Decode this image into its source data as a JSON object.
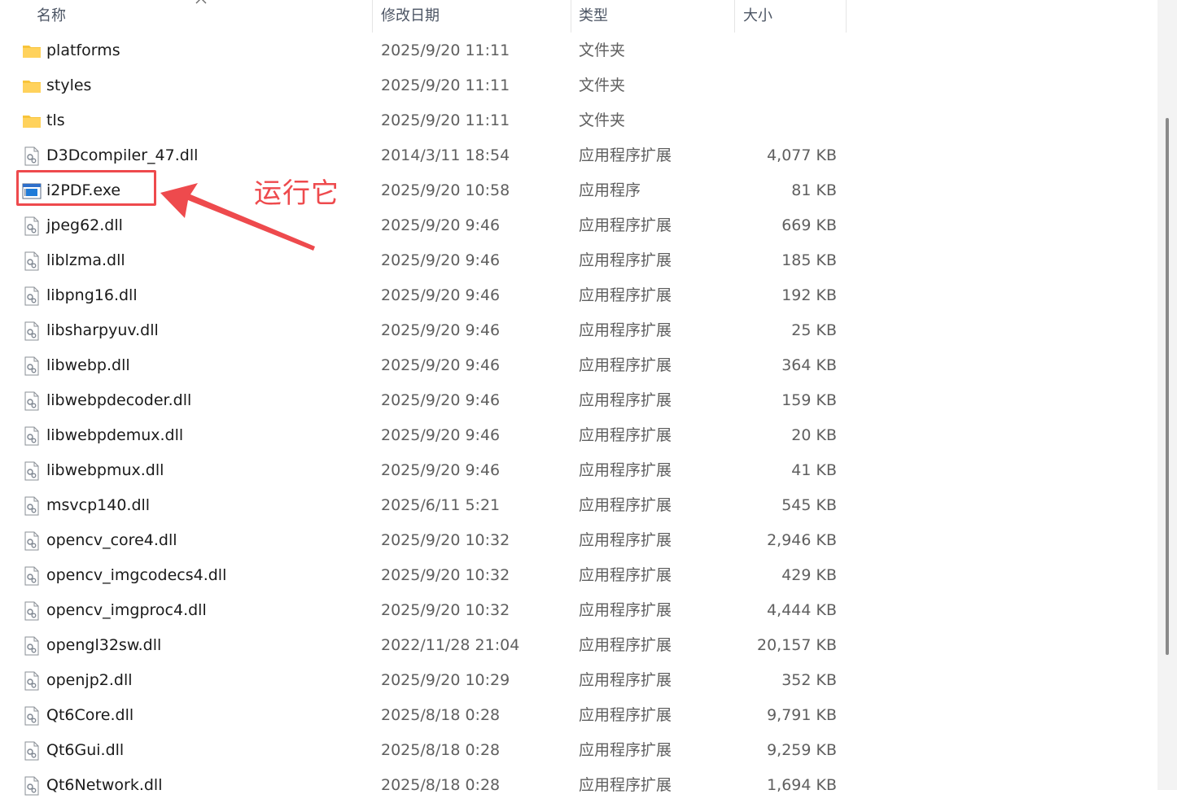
{
  "columns": {
    "name": "名称",
    "date": "修改日期",
    "type": "类型",
    "size": "大小"
  },
  "annotation": {
    "label": "运行它",
    "color": "#ee4a4d"
  },
  "files": [
    {
      "name": "platforms",
      "date": "2025/9/20 11:11",
      "type": "文件夹",
      "size": "",
      "icon": "folder-icon"
    },
    {
      "name": "styles",
      "date": "2025/9/20 11:11",
      "type": "文件夹",
      "size": "",
      "icon": "folder-icon"
    },
    {
      "name": "tls",
      "date": "2025/9/20 11:11",
      "type": "文件夹",
      "size": "",
      "icon": "folder-icon"
    },
    {
      "name": "D3Dcompiler_47.dll",
      "date": "2014/3/11 18:54",
      "type": "应用程序扩展",
      "size": "4,077 KB",
      "icon": "dll-file-icon"
    },
    {
      "name": "i2PDF.exe",
      "date": "2025/9/20 10:58",
      "type": "应用程序",
      "size": "81 KB",
      "icon": "exe-file-icon"
    },
    {
      "name": "jpeg62.dll",
      "date": "2025/9/20 9:46",
      "type": "应用程序扩展",
      "size": "669 KB",
      "icon": "dll-file-icon"
    },
    {
      "name": "liblzma.dll",
      "date": "2025/9/20 9:46",
      "type": "应用程序扩展",
      "size": "185 KB",
      "icon": "dll-file-icon"
    },
    {
      "name": "libpng16.dll",
      "date": "2025/9/20 9:46",
      "type": "应用程序扩展",
      "size": "192 KB",
      "icon": "dll-file-icon"
    },
    {
      "name": "libsharpyuv.dll",
      "date": "2025/9/20 9:46",
      "type": "应用程序扩展",
      "size": "25 KB",
      "icon": "dll-file-icon"
    },
    {
      "name": "libwebp.dll",
      "date": "2025/9/20 9:46",
      "type": "应用程序扩展",
      "size": "364 KB",
      "icon": "dll-file-icon"
    },
    {
      "name": "libwebpdecoder.dll",
      "date": "2025/9/20 9:46",
      "type": "应用程序扩展",
      "size": "159 KB",
      "icon": "dll-file-icon"
    },
    {
      "name": "libwebpdemux.dll",
      "date": "2025/9/20 9:46",
      "type": "应用程序扩展",
      "size": "20 KB",
      "icon": "dll-file-icon"
    },
    {
      "name": "libwebpmux.dll",
      "date": "2025/9/20 9:46",
      "type": "应用程序扩展",
      "size": "41 KB",
      "icon": "dll-file-icon"
    },
    {
      "name": "msvcp140.dll",
      "date": "2025/6/11 5:21",
      "type": "应用程序扩展",
      "size": "545 KB",
      "icon": "dll-file-icon"
    },
    {
      "name": "opencv_core4.dll",
      "date": "2025/9/20 10:32",
      "type": "应用程序扩展",
      "size": "2,946 KB",
      "icon": "dll-file-icon"
    },
    {
      "name": "opencv_imgcodecs4.dll",
      "date": "2025/9/20 10:32",
      "type": "应用程序扩展",
      "size": "429 KB",
      "icon": "dll-file-icon"
    },
    {
      "name": "opencv_imgproc4.dll",
      "date": "2025/9/20 10:32",
      "type": "应用程序扩展",
      "size": "4,444 KB",
      "icon": "dll-file-icon"
    },
    {
      "name": "opengl32sw.dll",
      "date": "2022/11/28 21:04",
      "type": "应用程序扩展",
      "size": "20,157 KB",
      "icon": "dll-file-icon"
    },
    {
      "name": "openjp2.dll",
      "date": "2025/9/20 10:29",
      "type": "应用程序扩展",
      "size": "352 KB",
      "icon": "dll-file-icon"
    },
    {
      "name": "Qt6Core.dll",
      "date": "2025/8/18 0:28",
      "type": "应用程序扩展",
      "size": "9,791 KB",
      "icon": "dll-file-icon"
    },
    {
      "name": "Qt6Gui.dll",
      "date": "2025/8/18 0:28",
      "type": "应用程序扩展",
      "size": "9,259 KB",
      "icon": "dll-file-icon"
    },
    {
      "name": "Qt6Network.dll",
      "date": "2025/8/18 0:28",
      "type": "应用程序扩展",
      "size": "1,694 KB",
      "icon": "dll-file-icon"
    }
  ]
}
